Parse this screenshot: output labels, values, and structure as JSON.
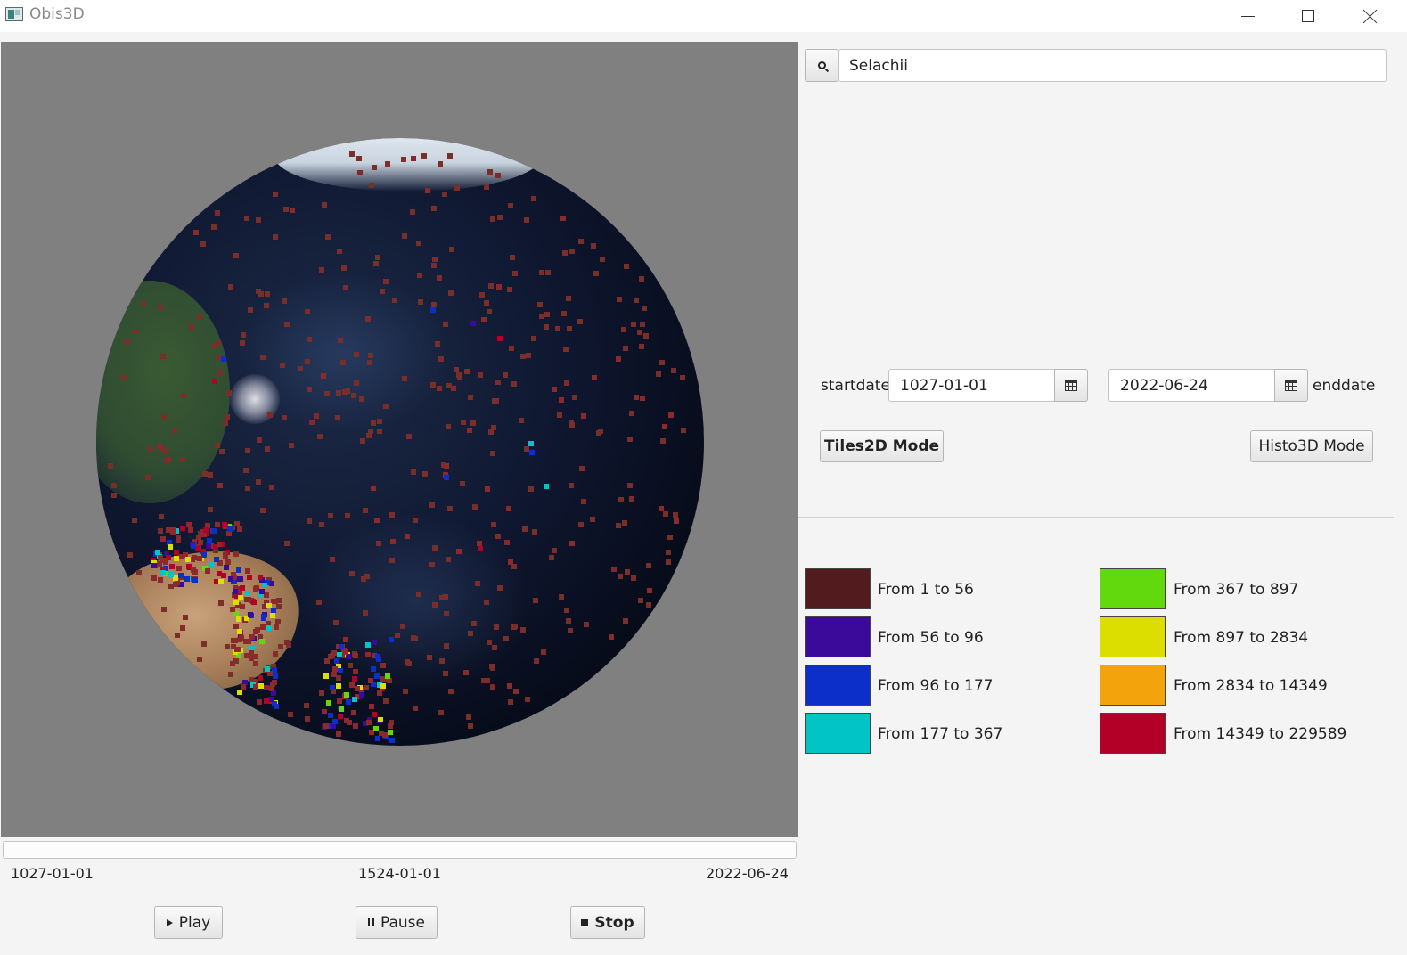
{
  "window": {
    "title": "Obis3D"
  },
  "search": {
    "value": "Selachii"
  },
  "dates": {
    "start_label": "startdate",
    "start_value": "1027-01-01",
    "end_label": "enddate",
    "end_value": "2022-06-24"
  },
  "modes": {
    "tiles_label": "Tiles2D Mode",
    "histo_label": "Histo3D Mode"
  },
  "timeline": {
    "start": "1027-01-01",
    "mid": "1524-01-01",
    "end": "2022-06-24"
  },
  "controls": {
    "play_label": "Play",
    "pause_label": "Pause",
    "stop_label": "Stop"
  },
  "legend": [
    {
      "label": "From 1 to 56",
      "color": "#521c1e"
    },
    {
      "label": "From 56 to 96",
      "color": "#3c0a9a"
    },
    {
      "label": "From 96 to 177",
      "color": "#0b2fc8"
    },
    {
      "label": "From 177 to 367",
      "color": "#00c4c6"
    },
    {
      "label": "From 367 to 897",
      "color": "#62d90c"
    },
    {
      "label": "From 897 to 2834",
      "color": "#dcde00"
    },
    {
      "label": "From 2834 to 14349",
      "color": "#f3a30c"
    },
    {
      "label": "From 14349 to 229589",
      "color": "#b20026"
    }
  ]
}
